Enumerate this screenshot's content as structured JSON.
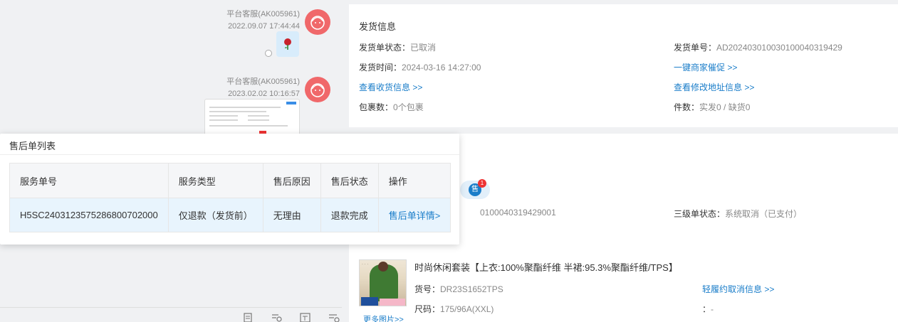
{
  "chat": {
    "messages": [
      {
        "sender": "平台客服(AK005961)",
        "time": "2022.09.07 17:44:44"
      },
      {
        "sender": "平台客服(AK005961)",
        "time": "2023.02.02 10:16:57"
      }
    ]
  },
  "shipping": {
    "title": "发货信息",
    "status_label": "发货单状态：",
    "status_value": "已取消",
    "number_label": "发货单号：",
    "number_value": "AD20240301003010004031942​9",
    "time_label": "发货时间：",
    "time_value": "2024-03-16 14:27:00",
    "urge_link": "一键商家催促 >>",
    "view_receiver_link": "查看收货信息 >>",
    "view_address_change_link": "查看修改地址信息 >>",
    "package_label": "包裹数：",
    "package_value": "0个包裹",
    "pieces_label": "件数：",
    "pieces_value": "实发0 / 缺货0"
  },
  "order": {
    "sale_badge": "售",
    "sale_count": "1",
    "number_partial": "0100040319429001",
    "level3_label": "三级单状态：",
    "level3_value": "系统取消（已支付）"
  },
  "product": {
    "name": "时尚休闲套装【上衣:100%聚酯纤维 半裙:95.3%聚酯纤维/TPS】",
    "sku_label": "货号：",
    "sku_value": "DR23S1652TPS",
    "size_label": "尺码：",
    "size_value": "175/96A(XXL)",
    "cancel_link": "轻履约取消信息 >>",
    "extra_label": "：",
    "extra_value": "-",
    "more_images": "更多图片>>"
  },
  "after_sale": {
    "title": "售后单列表",
    "columns": [
      "服务单号",
      "服务类型",
      "售后原因",
      "售后状态",
      "操作"
    ],
    "rows": [
      {
        "service_no": "H5SC240312357528680070​2000",
        "service_type": "仅退款（发货前）",
        "reason": "无理由",
        "status": "退款完成",
        "action": "售后单详情>"
      }
    ]
  }
}
